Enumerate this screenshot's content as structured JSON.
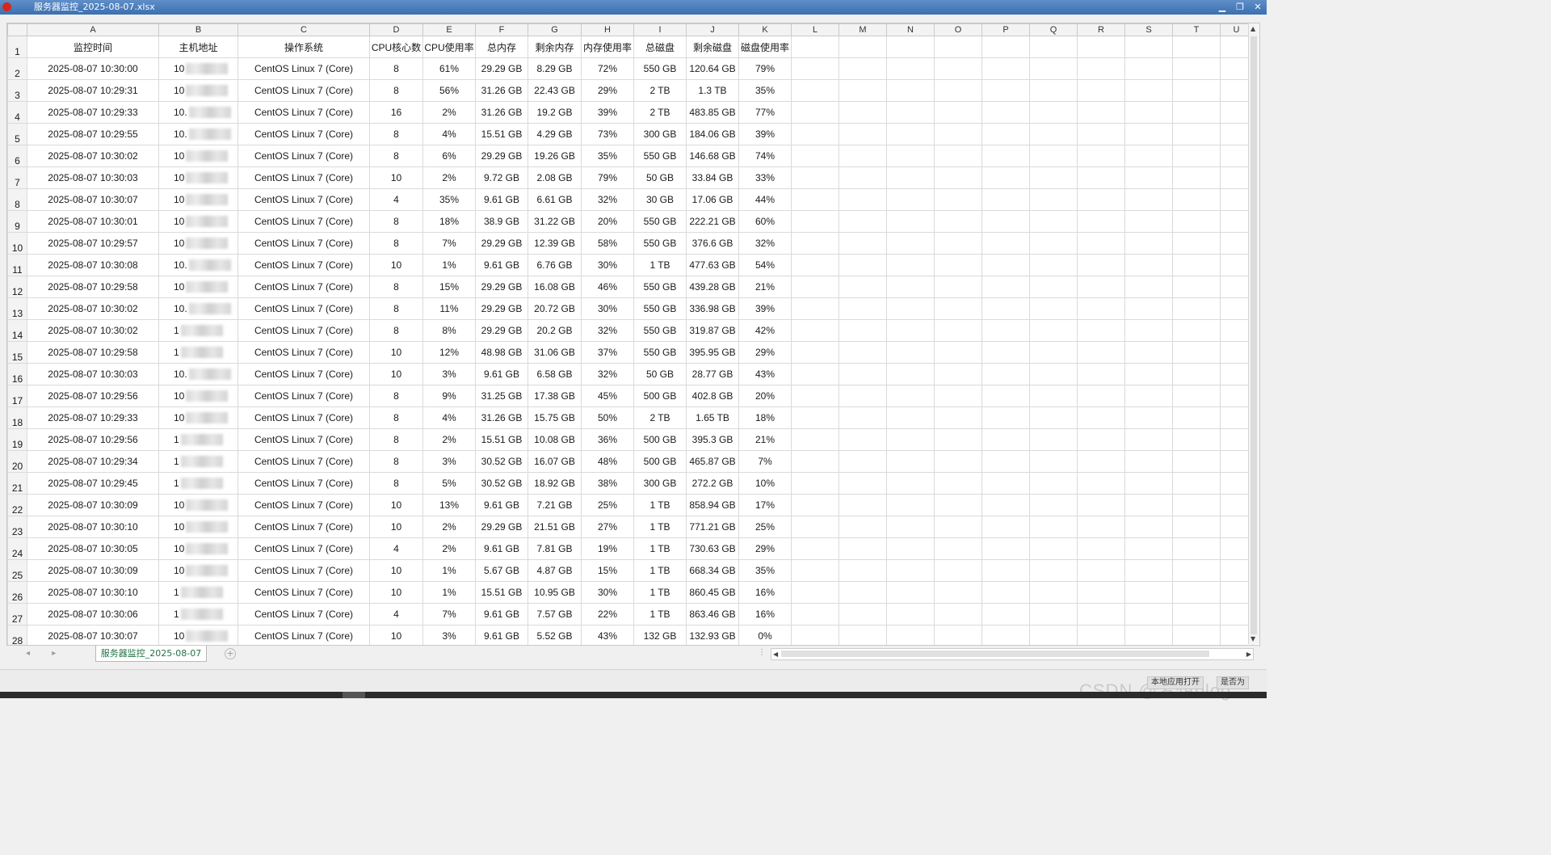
{
  "window": {
    "title": "服务器监控_2025-08-07.xlsx",
    "buttons": [
      "▁",
      "❐",
      "✕"
    ]
  },
  "sheet": {
    "columns": [
      "A",
      "B",
      "C",
      "D",
      "E",
      "F",
      "G",
      "H",
      "I",
      "J",
      "K",
      "L",
      "M",
      "N",
      "O",
      "P",
      "Q",
      "R",
      "S",
      "T",
      "U"
    ],
    "headers": [
      "监控时间",
      "主机地址",
      "操作系统",
      "CPU核心数",
      "CPU使用率",
      "总内存",
      "剩余内存",
      "内存使用率",
      "总磁盘",
      "剩余磁盘",
      "磁盘使用率"
    ],
    "rows": [
      [
        "2025-08-07 10:30:00",
        "10",
        "CentOS Linux 7 (Core)",
        "8",
        "61%",
        "29.29 GB",
        "8.29 GB",
        "72%",
        "550 GB",
        "120.64 GB",
        "79%"
      ],
      [
        "2025-08-07 10:29:31",
        "10",
        "CentOS Linux 7 (Core)",
        "8",
        "56%",
        "31.26 GB",
        "22.43 GB",
        "29%",
        "2 TB",
        "1.3 TB",
        "35%"
      ],
      [
        "2025-08-07 10:29:33",
        "10.",
        "CentOS Linux 7 (Core)",
        "16",
        "2%",
        "31.26 GB",
        "19.2 GB",
        "39%",
        "2 TB",
        "483.85 GB",
        "77%"
      ],
      [
        "2025-08-07 10:29:55",
        "10.",
        "CentOS Linux 7 (Core)",
        "8",
        "4%",
        "15.51 GB",
        "4.29 GB",
        "73%",
        "300 GB",
        "184.06 GB",
        "39%"
      ],
      [
        "2025-08-07 10:30:02",
        "10",
        "CentOS Linux 7 (Core)",
        "8",
        "6%",
        "29.29 GB",
        "19.26 GB",
        "35%",
        "550 GB",
        "146.68 GB",
        "74%"
      ],
      [
        "2025-08-07 10:30:03",
        "10",
        "CentOS Linux 7 (Core)",
        "10",
        "2%",
        "9.72 GB",
        "2.08 GB",
        "79%",
        "50 GB",
        "33.84 GB",
        "33%"
      ],
      [
        "2025-08-07 10:30:07",
        "10",
        "CentOS Linux 7 (Core)",
        "4",
        "35%",
        "9.61 GB",
        "6.61 GB",
        "32%",
        "30 GB",
        "17.06 GB",
        "44%"
      ],
      [
        "2025-08-07 10:30:01",
        "10",
        "CentOS Linux 7 (Core)",
        "8",
        "18%",
        "38.9 GB",
        "31.22 GB",
        "20%",
        "550 GB",
        "222.21 GB",
        "60%"
      ],
      [
        "2025-08-07 10:29:57",
        "10",
        "CentOS Linux 7 (Core)",
        "8",
        "7%",
        "29.29 GB",
        "12.39 GB",
        "58%",
        "550 GB",
        "376.6 GB",
        "32%"
      ],
      [
        "2025-08-07 10:30:08",
        "10.",
        "CentOS Linux 7 (Core)",
        "10",
        "1%",
        "9.61 GB",
        "6.76 GB",
        "30%",
        "1 TB",
        "477.63 GB",
        "54%"
      ],
      [
        "2025-08-07 10:29:58",
        "10",
        "CentOS Linux 7 (Core)",
        "8",
        "15%",
        "29.29 GB",
        "16.08 GB",
        "46%",
        "550 GB",
        "439.28 GB",
        "21%"
      ],
      [
        "2025-08-07 10:30:02",
        "10.",
        "CentOS Linux 7 (Core)",
        "8",
        "11%",
        "29.29 GB",
        "20.72 GB",
        "30%",
        "550 GB",
        "336.98 GB",
        "39%"
      ],
      [
        "2025-08-07 10:30:02",
        "1",
        "CentOS Linux 7 (Core)",
        "8",
        "8%",
        "29.29 GB",
        "20.2 GB",
        "32%",
        "550 GB",
        "319.87 GB",
        "42%"
      ],
      [
        "2025-08-07 10:29:58",
        "1",
        "CentOS Linux 7 (Core)",
        "10",
        "12%",
        "48.98 GB",
        "31.06 GB",
        "37%",
        "550 GB",
        "395.95 GB",
        "29%"
      ],
      [
        "2025-08-07 10:30:03",
        "10.",
        "CentOS Linux 7 (Core)",
        "10",
        "3%",
        "9.61 GB",
        "6.58 GB",
        "32%",
        "50 GB",
        "28.77 GB",
        "43%"
      ],
      [
        "2025-08-07 10:29:56",
        "10",
        "CentOS Linux 7 (Core)",
        "8",
        "9%",
        "31.25 GB",
        "17.38 GB",
        "45%",
        "500 GB",
        "402.8 GB",
        "20%"
      ],
      [
        "2025-08-07 10:29:33",
        "10",
        "CentOS Linux 7 (Core)",
        "8",
        "4%",
        "31.26 GB",
        "15.75 GB",
        "50%",
        "2 TB",
        "1.65 TB",
        "18%"
      ],
      [
        "2025-08-07 10:29:56",
        "1",
        "CentOS Linux 7 (Core)",
        "8",
        "2%",
        "15.51 GB",
        "10.08 GB",
        "36%",
        "500 GB",
        "395.3 GB",
        "21%"
      ],
      [
        "2025-08-07 10:29:34",
        "1",
        "CentOS Linux 7 (Core)",
        "8",
        "3%",
        "30.52 GB",
        "16.07 GB",
        "48%",
        "500 GB",
        "465.87 GB",
        "7%"
      ],
      [
        "2025-08-07 10:29:45",
        "1",
        "CentOS Linux 7 (Core)",
        "8",
        "5%",
        "30.52 GB",
        "18.92 GB",
        "38%",
        "300 GB",
        "272.2 GB",
        "10%"
      ],
      [
        "2025-08-07 10:30:09",
        "10",
        "CentOS Linux 7 (Core)",
        "10",
        "13%",
        "9.61 GB",
        "7.21 GB",
        "25%",
        "1 TB",
        "858.94 GB",
        "17%"
      ],
      [
        "2025-08-07 10:30:10",
        "10",
        "CentOS Linux 7 (Core)",
        "10",
        "2%",
        "29.29 GB",
        "21.51 GB",
        "27%",
        "1 TB",
        "771.21 GB",
        "25%"
      ],
      [
        "2025-08-07 10:30:05",
        "10",
        "CentOS Linux 7 (Core)",
        "4",
        "2%",
        "9.61 GB",
        "7.81 GB",
        "19%",
        "1 TB",
        "730.63 GB",
        "29%"
      ],
      [
        "2025-08-07 10:30:09",
        "10",
        "CentOS Linux 7 (Core)",
        "10",
        "1%",
        "5.67 GB",
        "4.87 GB",
        "15%",
        "1 TB",
        "668.34 GB",
        "35%"
      ],
      [
        "2025-08-07 10:30:10",
        "1",
        "CentOS Linux 7 (Core)",
        "10",
        "1%",
        "15.51 GB",
        "10.95 GB",
        "30%",
        "1 TB",
        "860.45 GB",
        "16%"
      ],
      [
        "2025-08-07 10:30:06",
        "1",
        "CentOS Linux 7 (Core)",
        "4",
        "7%",
        "9.61 GB",
        "7.57 GB",
        "22%",
        "1 TB",
        "863.46 GB",
        "16%"
      ],
      [
        "2025-08-07 10:30:07",
        "10",
        "CentOS Linux 7 (Core)",
        "10",
        "3%",
        "9.61 GB",
        "5.52 GB",
        "43%",
        "132 GB",
        "132.93 GB",
        "0%"
      ]
    ]
  },
  "tabs": {
    "active": "服务器监控_2025-08-07",
    "nav": "◂ ▸",
    "add": "+",
    "separator": "⋮"
  },
  "status": {
    "watermark": "CSDN @梦想blog",
    "btn1": "本地应用打开",
    "btn2": "是否为"
  }
}
